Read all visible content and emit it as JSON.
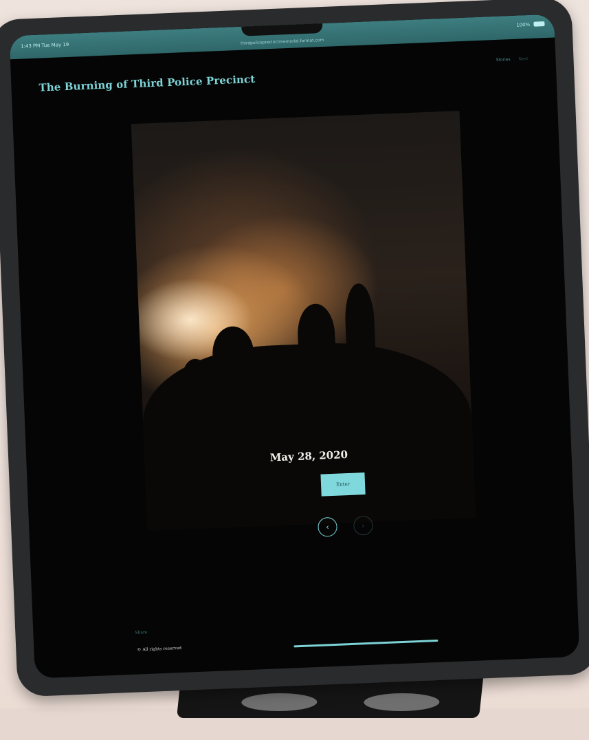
{
  "status_bar": {
    "time": "1:43 PM  Tue May 19",
    "url": "thirdpoliceprecinctmemorial.format.com",
    "dots": "•••",
    "battery": "100%"
  },
  "site": {
    "title": "The Burning of Third Police Precinct",
    "nav": [
      "Stories",
      "Next"
    ]
  },
  "hero": {
    "date": "May 28, 2020",
    "enter_label": "Enter",
    "prev_icon": "‹",
    "next_icon": "›"
  },
  "footer": {
    "share_label": "Share",
    "copyright": "© All rights reserved"
  },
  "colors": {
    "accent": "#7dd3d6",
    "status_bar": "#3d7d80",
    "background": "#050505"
  }
}
